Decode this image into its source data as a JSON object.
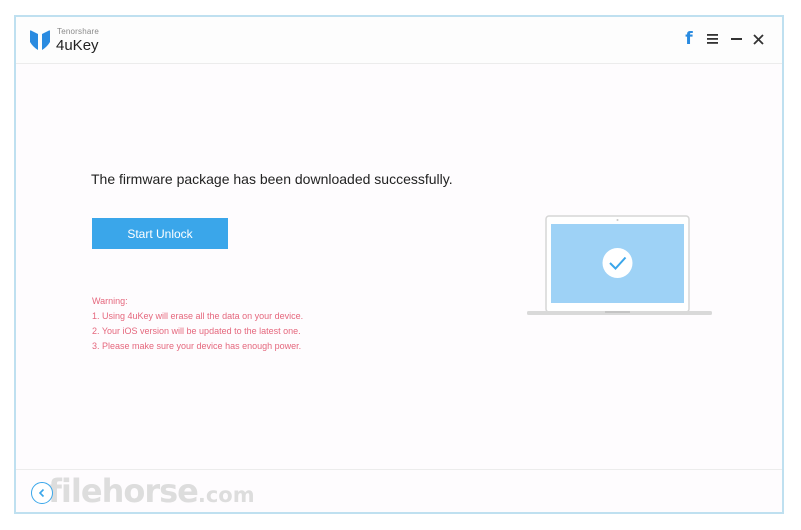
{
  "app": {
    "vendor": "Tenorshare",
    "name": "4uKey"
  },
  "titlebar": {
    "facebook_icon": "facebook-icon",
    "facebook_glyph": "f",
    "menu_icon": "menu-icon",
    "minimize_icon": "minimize-icon",
    "close_icon": "close-icon"
  },
  "main": {
    "message": "The firmware package has been downloaded successfully.",
    "start_button_label": "Start Unlock",
    "warning": {
      "title": "Warning:",
      "items": [
        "1. Using 4uKey will erase all the data on your device.",
        "2. Your iOS version will be updated to the latest one.",
        "3. Please make sure your device has enough power."
      ]
    },
    "illustration": "laptop-checkmark-icon"
  },
  "footer": {
    "back_icon": "back-arrow-icon"
  },
  "watermark": {
    "text": "filehorse",
    "suffix": ".com"
  },
  "colors": {
    "accent": "#3aa6ea",
    "warning": "#e5677d",
    "screen": "#9ed2f6",
    "border": "#bfe0f0"
  }
}
